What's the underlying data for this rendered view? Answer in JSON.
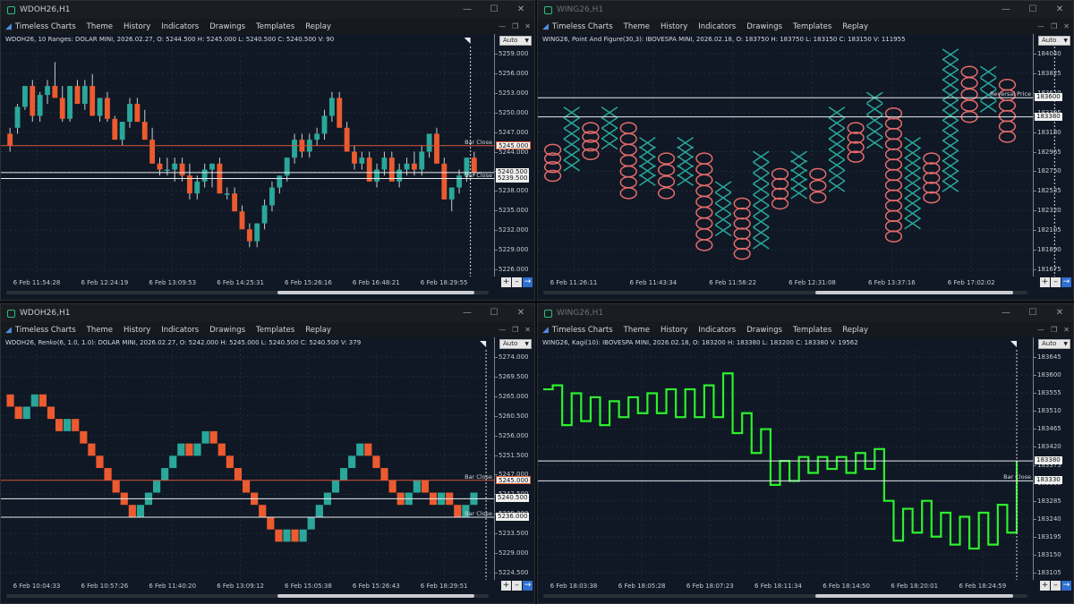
{
  "windows": [
    {
      "title": "WDOH26,H1",
      "dim": false,
      "menu": [
        "Timeless Charts",
        "Theme",
        "History",
        "Indicators",
        "Drawings",
        "Templates",
        "Replay"
      ],
      "info": "WDOH26, 10 Ranges: DOLAR MINI, 2026.02.27, O: 5244.500 H: 5245.000 L: 5240.500 C: 5240.500 V: 90",
      "scale_button": "Auto",
      "price_labels": [
        "5259.000",
        "5256.000",
        "5253.000",
        "5250.000",
        "5247.000",
        "5244.000",
        "5241.000",
        "5238.000",
        "5235.000",
        "5232.000",
        "5229.000",
        "5226.000"
      ],
      "price_boxes": [
        {
          "text": "5245.000",
          "style": "red",
          "label": "Bar Close"
        },
        {
          "text": "5240.500",
          "style": "plain",
          "label": ""
        },
        {
          "text": "5239.500",
          "style": "plain",
          "label": "Bar Close"
        }
      ],
      "time_labels": [
        "6 Feb 11:54:28",
        "6 Feb 12:24:19",
        "6 Feb 13:09:53",
        "6 Feb 14:25:31",
        "6 Feb 15:26:16",
        "6 Feb 16:48:21",
        "6 Feb 18:29:55"
      ],
      "chart_data": {
        "type": "candlestick",
        "ylim": [
          5224,
          5261
        ],
        "candles": [
          [
            5247,
            5248,
            5244,
            5245
          ],
          [
            5248,
            5252,
            5247,
            5251.5
          ],
          [
            5251.5,
            5255,
            5251,
            5255
          ],
          [
            5255,
            5256,
            5249,
            5250
          ],
          [
            5250,
            5254,
            5249,
            5253.5
          ],
          [
            5253.5,
            5256,
            5252,
            5255
          ],
          [
            5255,
            5259,
            5254,
            5253
          ],
          [
            5253,
            5255,
            5249,
            5249.5
          ],
          [
            5249.5,
            5255,
            5249,
            5255
          ],
          [
            5255,
            5256,
            5252,
            5252
          ],
          [
            5252,
            5256,
            5251,
            5255
          ],
          [
            5255,
            5257,
            5250,
            5250
          ],
          [
            5250,
            5253,
            5249,
            5253
          ],
          [
            5253,
            5254,
            5249,
            5249.5
          ],
          [
            5249.5,
            5250,
            5246,
            5246
          ],
          [
            5246,
            5249,
            5245,
            5249
          ],
          [
            5249,
            5253,
            5248,
            5252
          ],
          [
            5252,
            5253,
            5249,
            5249
          ],
          [
            5249,
            5251,
            5246,
            5246
          ],
          [
            5246,
            5248,
            5242,
            5242
          ],
          [
            5242,
            5243,
            5240,
            5241
          ],
          [
            5241,
            5243,
            5240,
            5241
          ],
          [
            5241,
            5243,
            5239,
            5242
          ],
          [
            5242,
            5243,
            5239,
            5240
          ],
          [
            5240,
            5242,
            5236,
            5237
          ],
          [
            5237,
            5240,
            5236,
            5239
          ],
          [
            5239,
            5242,
            5238,
            5241
          ],
          [
            5241,
            5242,
            5238,
            5242
          ],
          [
            5242,
            5243,
            5237,
            5237
          ],
          [
            5237,
            5238,
            5236,
            5237
          ],
          [
            5237,
            5238,
            5234,
            5234
          ],
          [
            5234,
            5235,
            5231,
            5231
          ],
          [
            5231,
            5232,
            5228,
            5229
          ],
          [
            5229,
            5232,
            5228,
            5232
          ],
          [
            5232,
            5236,
            5231,
            5235
          ],
          [
            5235,
            5239,
            5234,
            5238
          ],
          [
            5238,
            5240,
            5237,
            5240
          ],
          [
            5240,
            5243,
            5239,
            5243
          ],
          [
            5243,
            5247,
            5242,
            5246
          ],
          [
            5246,
            5247,
            5243,
            5244
          ],
          [
            5244,
            5247,
            5243,
            5246
          ],
          [
            5246,
            5248,
            5245,
            5247
          ],
          [
            5247,
            5251,
            5246,
            5250
          ],
          [
            5250,
            5254,
            5249,
            5253
          ],
          [
            5253,
            5254,
            5248,
            5248
          ],
          [
            5248,
            5249,
            5244,
            5244
          ],
          [
            5244,
            5245,
            5241,
            5242
          ],
          [
            5242,
            5244,
            5241,
            5243
          ],
          [
            5243,
            5244,
            5239,
            5239
          ],
          [
            5239,
            5242,
            5238,
            5241
          ],
          [
            5241,
            5244,
            5240,
            5243
          ],
          [
            5243,
            5244,
            5239,
            5239
          ],
          [
            5239,
            5242,
            5238,
            5241
          ],
          [
            5241,
            5243,
            5240,
            5242
          ],
          [
            5242,
            5244,
            5240,
            5241
          ],
          [
            5241,
            5245,
            5240,
            5244
          ],
          [
            5244,
            5247,
            5243,
            5247
          ],
          [
            5247,
            5248,
            5242,
            5242
          ],
          [
            5242,
            5243,
            5236,
            5236
          ],
          [
            5236,
            5238,
            5234,
            5238
          ],
          [
            5238,
            5241,
            5237,
            5240
          ],
          [
            5240,
            5243,
            5239,
            5243
          ],
          [
            5243,
            5244,
            5240,
            5240.5
          ]
        ],
        "hlines": [
          5245.0,
          5240.5,
          5239.5
        ],
        "vline_index": 61
      }
    },
    {
      "title": "WING26,H1",
      "dim": true,
      "menu": [
        "Timeless Charts",
        "Theme",
        "History",
        "Indicators",
        "Drawings",
        "Templates",
        "Replay"
      ],
      "info": "WING26, Point And Figure(30,3): IBOVESPA MINI, 2026.02.18, O: 183750 H: 183750 L: 183150 C: 183150 V: 111955",
      "scale_button": "Auto",
      "price_labels": [
        "184040",
        "183825",
        "183610",
        "183395",
        "183180",
        "182965",
        "182750",
        "182535",
        "182320",
        "182105",
        "181890",
        "181675"
      ],
      "price_boxes": [
        {
          "text": "183600",
          "style": "plain",
          "label": "Reversal Price"
        },
        {
          "text": "183380",
          "style": "plain",
          "label": ""
        }
      ],
      "time_labels": [
        "6 Feb 11:26:11",
        "6 Feb 11:43:34",
        "6 Feb 11:58:22",
        "6 Feb 12:31:08",
        "6 Feb 13:37:16",
        "6 Feb 17:02:02"
      ],
      "chart_data": {
        "type": "point_and_figure",
        "box_size": 30,
        "reversal": 3,
        "ylim": [
          181600,
          184150
        ],
        "columns": [
          {
            "type": "O",
            "from": 183000,
            "to": 182700
          },
          {
            "type": "X",
            "from": 182820,
            "to": 183430
          },
          {
            "type": "O",
            "from": 183250,
            "to": 182950
          },
          {
            "type": "X",
            "from": 183070,
            "to": 183430
          },
          {
            "type": "O",
            "from": 183250,
            "to": 182500
          },
          {
            "type": "X",
            "from": 182650,
            "to": 183080
          },
          {
            "type": "O",
            "from": 182900,
            "to": 182500
          },
          {
            "type": "X",
            "from": 182650,
            "to": 183080
          },
          {
            "type": "O",
            "from": 182900,
            "to": 181900
          },
          {
            "type": "X",
            "from": 182070,
            "to": 182570
          },
          {
            "type": "O",
            "from": 182380,
            "to": 181800
          },
          {
            "type": "X",
            "from": 181920,
            "to": 182920
          },
          {
            "type": "O",
            "from": 182720,
            "to": 182380
          },
          {
            "type": "X",
            "from": 182500,
            "to": 182920
          },
          {
            "type": "O",
            "from": 182720,
            "to": 182450
          },
          {
            "type": "X",
            "from": 182580,
            "to": 183430
          },
          {
            "type": "O",
            "from": 183250,
            "to": 182920
          },
          {
            "type": "X",
            "from": 183080,
            "to": 183600
          },
          {
            "type": "O",
            "from": 183420,
            "to": 182000
          },
          {
            "type": "X",
            "from": 182150,
            "to": 183080
          },
          {
            "type": "O",
            "from": 182900,
            "to": 182450
          },
          {
            "type": "X",
            "from": 182580,
            "to": 184100
          },
          {
            "type": "O",
            "from": 183900,
            "to": 183380
          },
          {
            "type": "X",
            "from": 183500,
            "to": 183900
          },
          {
            "type": "O",
            "from": 183750,
            "to": 183150
          }
        ],
        "hlines": [
          183600,
          183380
        ],
        "vline_index": 26
      }
    },
    {
      "title": "WDOH26,H1",
      "dim": false,
      "menu": [
        "Timeless Charts",
        "Theme",
        "History",
        "Indicators",
        "Drawings",
        "Templates",
        "Replay"
      ],
      "info": "WDOH26, Renko(6, 1.0, 1.0): DOLAR MINI, 2026.02.27, O: 5242.000 H: 5245.000 L: 5240.500 C: 5240.500 V: 379",
      "scale_button": "Auto",
      "price_labels": [
        "5274.000",
        "5269.500",
        "5265.000",
        "5260.500",
        "5256.000",
        "5251.500",
        "5247.000",
        "5242.500",
        "5238.000",
        "5233.500",
        "5229.000",
        "5224.500"
      ],
      "price_boxes": [
        {
          "text": "5245.000",
          "style": "red",
          "label": "Bar Close"
        },
        {
          "text": "5240.500",
          "style": "plain",
          "label": ""
        },
        {
          "text": "5236.000",
          "style": "plain",
          "label": "Bar Close"
        }
      ],
      "time_labels": [
        "6 Feb 10:04:33",
        "6 Feb 10:57:26",
        "6 Feb 11:40:20",
        "6 Feb 13:09:12",
        "6 Feb 15:05:38",
        "6 Feb 15:26:43",
        "6 Feb 18:29:51"
      ],
      "chart_data": {
        "type": "renko",
        "brick_size": 3,
        "ylim": [
          5222,
          5276
        ],
        "bricks": [
          [
            5266,
            5263
          ],
          [
            5263,
            5260
          ],
          [
            5260,
            5263
          ],
          [
            5263,
            5266
          ],
          [
            5266,
            5263
          ],
          [
            5263,
            5260
          ],
          [
            5260,
            5257
          ],
          [
            5257,
            5260
          ],
          [
            5260,
            5257
          ],
          [
            5257,
            5254
          ],
          [
            5254,
            5251
          ],
          [
            5251,
            5248
          ],
          [
            5248,
            5245
          ],
          [
            5245,
            5242
          ],
          [
            5242,
            5239
          ],
          [
            5239,
            5236
          ],
          [
            5236,
            5239
          ],
          [
            5239,
            5242
          ],
          [
            5242,
            5245
          ],
          [
            5245,
            5248
          ],
          [
            5248,
            5251
          ],
          [
            5251,
            5254
          ],
          [
            5254,
            5251
          ],
          [
            5251,
            5254
          ],
          [
            5254,
            5257
          ],
          [
            5257,
            5254
          ],
          [
            5254,
            5251
          ],
          [
            5251,
            5248
          ],
          [
            5248,
            5245
          ],
          [
            5245,
            5242
          ],
          [
            5242,
            5239
          ],
          [
            5239,
            5236
          ],
          [
            5236,
            5233
          ],
          [
            5233,
            5230
          ],
          [
            5230,
            5233
          ],
          [
            5233,
            5230
          ],
          [
            5230,
            5233
          ],
          [
            5233,
            5236
          ],
          [
            5236,
            5239
          ],
          [
            5239,
            5242
          ],
          [
            5242,
            5245
          ],
          [
            5245,
            5248
          ],
          [
            5248,
            5251
          ],
          [
            5251,
            5254
          ],
          [
            5254,
            5251
          ],
          [
            5251,
            5248
          ],
          [
            5248,
            5245
          ],
          [
            5245,
            5242
          ],
          [
            5242,
            5239
          ],
          [
            5239,
            5242
          ],
          [
            5242,
            5245
          ],
          [
            5245,
            5242
          ],
          [
            5242,
            5239
          ],
          [
            5239,
            5242
          ],
          [
            5242,
            5239
          ],
          [
            5239,
            5236
          ],
          [
            5236,
            5239
          ],
          [
            5239,
            5242
          ]
        ],
        "hlines": [
          5245.0,
          5240.5,
          5236.0
        ],
        "vline_index": 58
      }
    },
    {
      "title": "WING26,H1",
      "dim": true,
      "menu": [
        "Timeless Charts",
        "Theme",
        "History",
        "Indicators",
        "Drawings",
        "Templates",
        "Replay"
      ],
      "info": "WING26, Kagi(10): IBOVESPA MINI, 2026.02.18, O: 183200 H: 183380 L: 183200 C: 183380 V: 19562",
      "scale_button": "Auto",
      "price_labels": [
        "183645",
        "183600",
        "183555",
        "183510",
        "183465",
        "183420",
        "183375",
        "183330",
        "183285",
        "183240",
        "183195",
        "183150",
        "183105"
      ],
      "price_boxes": [
        {
          "text": "183380",
          "style": "plain",
          "label": ""
        },
        {
          "text": "183330",
          "style": "plain",
          "label": "Bar Close"
        }
      ],
      "time_labels": [
        "6 Feb 18:03:38",
        "6 Feb 18:05:28",
        "6 Feb 18:07:23",
        "6 Feb 18:11:34",
        "6 Feb 18:14:50",
        "6 Feb 18:20:01",
        "6 Feb 18:24:59"
      ],
      "chart_data": {
        "type": "kagi",
        "reversal": 10,
        "ylim": [
          183095,
          183650
        ],
        "values": [
          183560,
          183570,
          183470,
          183550,
          183480,
          183540,
          183470,
          183530,
          183490,
          183540,
          183500,
          183550,
          183500,
          183560,
          183490,
          183560,
          183490,
          183570,
          183490,
          183600,
          183450,
          183500,
          183400,
          183460,
          183320,
          183380,
          183330,
          183390,
          183350,
          183390,
          183360,
          183390,
          183350,
          183400,
          183360,
          183410,
          183280,
          183180,
          183260,
          183200,
          183280,
          183190,
          183250,
          183170,
          183240,
          183160,
          183250,
          183170,
          183270,
          183200,
          183380
        ],
        "hlines": [
          183380,
          183330
        ],
        "vline_index": 50
      }
    }
  ]
}
